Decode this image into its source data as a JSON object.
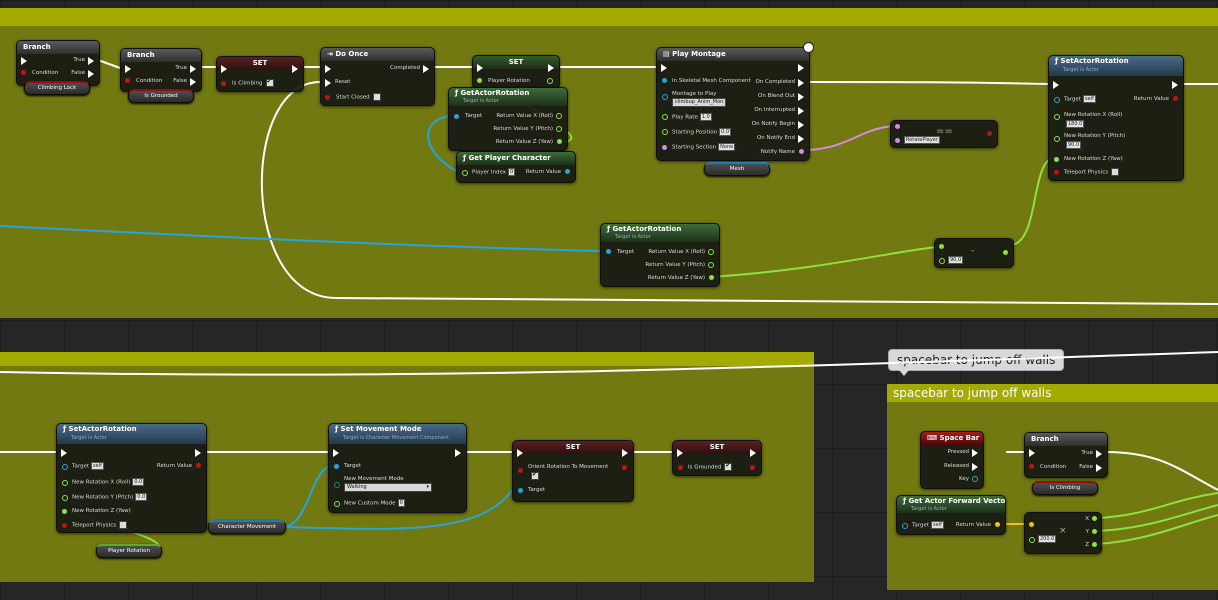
{
  "colors": {
    "background": "#262626",
    "comment_fill": "#848c0c",
    "comment_bar": "#a4ab00",
    "exec_wire": "#ffffff",
    "float_wire": "#8fe042",
    "object_wire": "#26a4e0",
    "bool_pin": "#c01414",
    "name_wire": "#d48ce6",
    "vector_wire": "#f0c020"
  },
  "comments": {
    "lower_right_bubble": "spacebar to jump off walls",
    "lower_right_title": "spacebar to jump off walls"
  },
  "nodes": {
    "branch1": {
      "title": "Branch",
      "condition": "Condition",
      "true": "True",
      "false": "False",
      "var": "Climbing Lock"
    },
    "branch2": {
      "title": "Branch",
      "condition": "Condition",
      "true": "True",
      "false": "False",
      "var": "Is Grounded"
    },
    "set_climbing": {
      "title": "SET",
      "label": "Is Climbing"
    },
    "do_once": {
      "title": "Do Once",
      "completed": "Completed",
      "reset": "Reset",
      "start_closed": "Start Closed"
    },
    "set_player_rotation": {
      "title": "SET",
      "label": "Player Rotation"
    },
    "get_actor_rotation1": {
      "title": "GetActorRotation",
      "sub": "Target is Actor",
      "target": "Target",
      "x": "Return Value X (Roll)",
      "y": "Return Value Y (Pitch)",
      "z": "Return Value Z (Yaw)"
    },
    "get_player_character": {
      "title": "Get Player Character",
      "index_label": "Player Index",
      "index_val": "0",
      "ret": "Return Value"
    },
    "play_montage": {
      "title": "Play Montage",
      "in_mesh": "In Skeletal Mesh Component",
      "montage": "Montage to Play",
      "montage_val": "climbup_Anim_Mon",
      "play_rate": "Play Rate",
      "play_rate_val": "1.0",
      "start_pos": "Starting Position",
      "start_pos_val": "0.0",
      "start_sec": "Starting Section",
      "start_sec_val": "None",
      "completed": "On Completed",
      "blended": "On Blend Out",
      "interrupted": "On Interrupted",
      "notify_begin": "On Notify Begin",
      "notify_end": "On Notify End",
      "notify_name": "Notify Name",
      "mesh_var": "Mesh"
    },
    "equal": {
      "symbol": "==",
      "val": "RotatePlayer"
    },
    "set_actor_rotation1": {
      "title": "SetActorRotation",
      "sub": "Target is Actor",
      "target": "Target",
      "target_val": "self",
      "ret": "Return Value",
      "x": "New Rotation X (Roll)",
      "x_val": "180.0",
      "y": "New Rotation Y (Pitch)",
      "y_val": "90.0",
      "z": "New Rotation Z (Yaw)",
      "teleport": "Teleport Physics"
    },
    "get_actor_rotation2": {
      "title": "GetActorRotation",
      "sub": "Target is Actor",
      "target": "Target",
      "x": "Return Value X (Roll)",
      "y": "Return Value Y (Pitch)",
      "z": "Return Value Z (Yaw)"
    },
    "subtract": {
      "symbol": "-",
      "val": "90.0"
    },
    "set_actor_rotation2": {
      "title": "SetActorRotation",
      "sub": "Target is Actor",
      "target": "Target",
      "target_val": "self",
      "ret": "Return Value",
      "x": "New Rotation X (Roll)",
      "x_val": "0.0",
      "y": "New Rotation Y (Pitch)",
      "y_val": "0.0",
      "z": "New Rotation Z (Yaw)",
      "teleport": "Teleport Physics",
      "var": "Player Rotation"
    },
    "set_movement_mode": {
      "title": "Set Movement Mode",
      "sub": "Target is Character Movement Component",
      "target": "Target",
      "mode": "New Movement Mode",
      "mode_val": "Walking",
      "custom": "New Custom Mode",
      "custom_val": "0",
      "var": "Character Movement"
    },
    "set_orient": {
      "title": "SET",
      "label": "Orient Rotation To Movement",
      "target": "Target"
    },
    "set_grounded": {
      "title": "SET",
      "label": "Is Grounded"
    },
    "space_bar": {
      "title": "Space Bar",
      "pressed": "Pressed",
      "released": "Released",
      "key": "Key"
    },
    "branch3": {
      "title": "Branch",
      "condition": "Condition",
      "true": "True",
      "false": "False",
      "var": "Is Climbing"
    },
    "get_forward": {
      "title": "Get Actor Forward Vector",
      "sub": "Target is Actor",
      "target": "Target",
      "target_val": "self",
      "ret": "Return Value"
    },
    "multiply": {
      "symbol": "×",
      "val": "200.0",
      "x": "X",
      "y": "Y",
      "z": "Z"
    }
  }
}
